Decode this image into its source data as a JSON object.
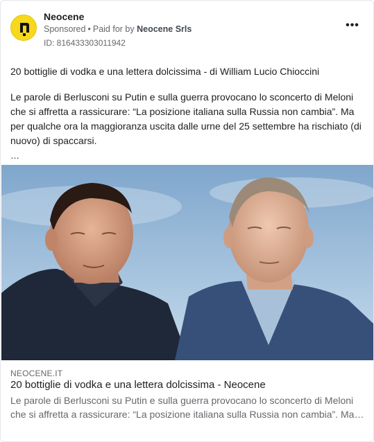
{
  "advertiser": {
    "name": "Neocene",
    "sponsored_label": "Sponsored",
    "separator": "•",
    "paid_for_prefix": "Paid for by",
    "paid_for_by": "Neocene Srls",
    "ad_id": "ID: 816433303011942",
    "logo_icon": "neocene-logo-icon",
    "logo_color": "#f7d81c"
  },
  "menu": {
    "more_label": "•••"
  },
  "post": {
    "headline": "20 bottiglie di vodka e una lettera dolcissima - di William Lucio Chioccini",
    "paragraph": "Le parole di Berlusconi su Putin e sulla guerra provocano lo sconcerto di Meloni che si affretta a rassicurare: “La posizione italiana sulla Russia non cambia”. Ma per qualche ora la maggioranza uscita dalle urne del 25 settembre ha rischiato (di nuovo) di spaccarsi.",
    "ellipsis": "…"
  },
  "link_preview": {
    "domain": "NEOCENE.IT",
    "title": "20 bottiglie di vodka e una lettera dolcissima - Neocene",
    "description": "Le parole di Berlusconi su Putin e sulla guerra provocano lo sconcerto di Meloni che si affretta a rassicurare: “La posizione italiana sulla Russia non cambia”. Ma per qualche ora la maggioranza uscita dalle urne del 25 settembre ha rischiato (di nuovo) di spaccarsi."
  },
  "colors": {
    "sky": "#8fb4d6",
    "suit_dark": "#1e2838",
    "suit_blue": "#36507a",
    "text_secondary": "#65676b"
  }
}
